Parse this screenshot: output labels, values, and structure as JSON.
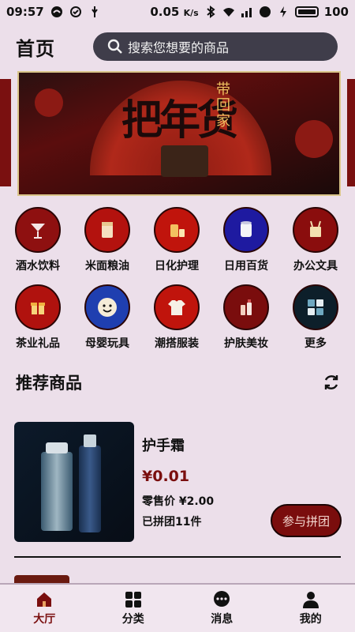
{
  "status_bar": {
    "time": "09:57",
    "speed": "0.05",
    "speed_unit": "K/s",
    "battery": "100"
  },
  "header": {
    "title": "首页",
    "search_placeholder": "搜索您想要的商品"
  },
  "categories": [
    {
      "label": "酒水饮料",
      "icon": "cocktail-icon",
      "color": "#8e1010"
    },
    {
      "label": "米面粮油",
      "icon": "rice-bag-icon",
      "color": "#b3120e"
    },
    {
      "label": "日化护理",
      "icon": "toiletries-icon",
      "color": "#c0140c"
    },
    {
      "label": "日用百货",
      "icon": "tissue-roll-icon",
      "color": "#1e1aa0"
    },
    {
      "label": "办公文具",
      "icon": "stationery-icon",
      "color": "#8a0d0d"
    },
    {
      "label": "茶业礼品",
      "icon": "gift-box-icon",
      "color": "#b0120e"
    },
    {
      "label": "母婴玩具",
      "icon": "baby-face-icon",
      "color": "#1f3fb0"
    },
    {
      "label": "潮搭服装",
      "icon": "tshirt-icon",
      "color": "#c0140c"
    },
    {
      "label": "护肤美妆",
      "icon": "cosmetics-icon",
      "color": "#7a0d0d"
    },
    {
      "label": "更多",
      "icon": "more-grid-icon",
      "color": "#0d1f2a"
    }
  ],
  "section": {
    "title": "推荐商品"
  },
  "product": {
    "name": "护手霜",
    "price": "¥0.01",
    "retail_price": "零售价 ¥2.00",
    "groups": "已拼团11件",
    "join_label": "参与拼团"
  },
  "tabbar": [
    {
      "label": "大厅",
      "icon": "home-icon",
      "active": true
    },
    {
      "label": "分类",
      "icon": "category-grid-icon",
      "active": false
    },
    {
      "label": "消息",
      "icon": "message-icon",
      "active": false
    },
    {
      "label": "我的",
      "icon": "user-icon",
      "active": false
    }
  ],
  "colors": {
    "accent": "#7a0e0e",
    "background": "#ecdfea",
    "search_bg": "#3f3d4a"
  }
}
